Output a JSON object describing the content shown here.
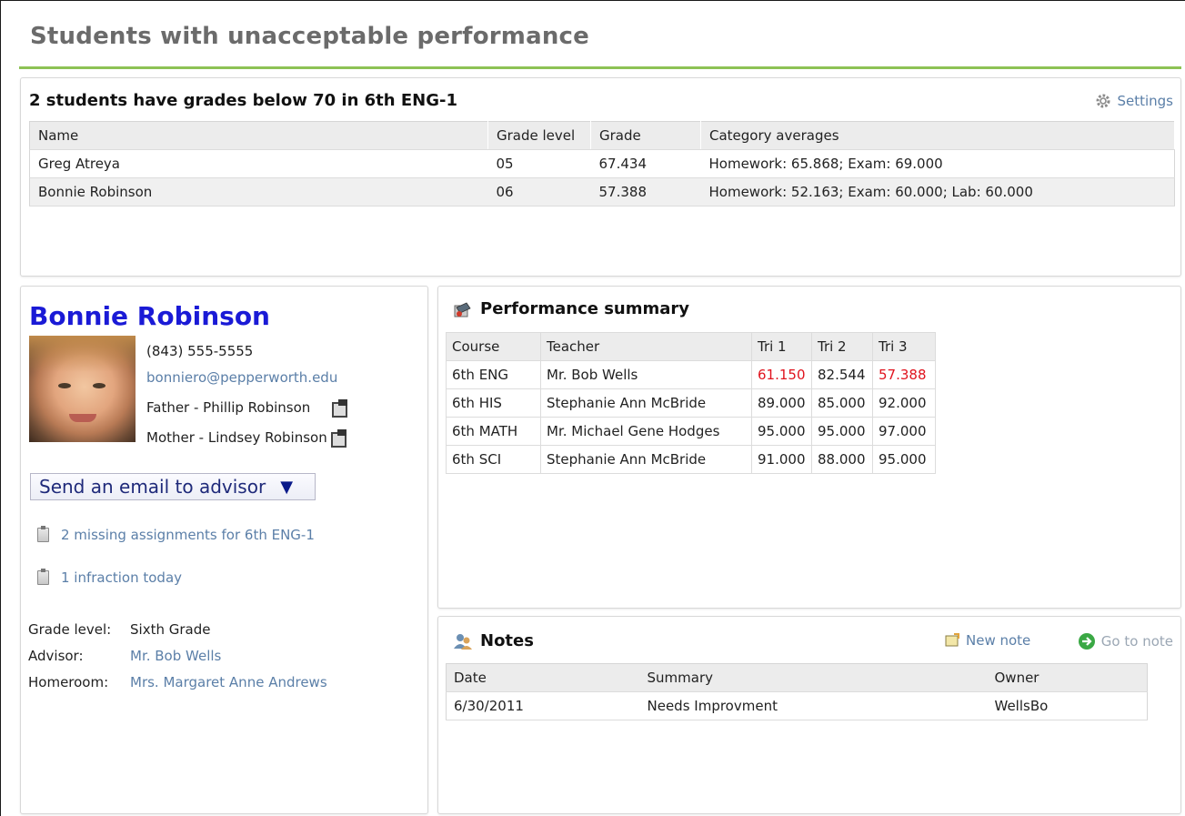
{
  "page": {
    "title": "Students with unacceptable performance"
  },
  "students_panel": {
    "heading": "2 students have grades below 70 in 6th ENG-1",
    "settings_label": "Settings",
    "columns": [
      "Name",
      "Grade level",
      "Grade",
      "Category averages"
    ],
    "rows": [
      {
        "name": "Greg Atreya",
        "grade_level": "05",
        "grade": "67.434",
        "category_averages": "Homework: 65.868; Exam: 69.000"
      },
      {
        "name": "Bonnie Robinson",
        "grade_level": "06",
        "grade": "57.388",
        "category_averages": "Homework: 52.163; Exam: 60.000; Lab: 60.000"
      }
    ]
  },
  "student": {
    "name": "Bonnie Robinson",
    "phone": "(843) 555-5555",
    "email": "bonniero@pepperworth.edu",
    "father": "Father - Phillip Robinson",
    "mother": "Mother - Lindsey Robinson",
    "email_advisor_label": "Send an email to advisor",
    "alerts": [
      "2 missing assignments for 6th ENG-1",
      "1 infraction today"
    ],
    "grade_level_label": "Grade level:",
    "grade_level": "Sixth Grade",
    "advisor_label": "Advisor:",
    "advisor": "Mr. Bob Wells",
    "homeroom_label": "Homeroom:",
    "homeroom": "Mrs. Margaret Anne Andrews"
  },
  "performance": {
    "heading": "Performance summary",
    "columns": [
      "Course",
      "Teacher",
      "Tri 1",
      "Tri 2",
      "Tri 3"
    ],
    "rows": [
      {
        "course": "6th ENG",
        "teacher": "Mr. Bob Wells",
        "tri1": "61.150",
        "tri2": "82.544",
        "tri3": "57.388",
        "tri1_low": true,
        "tri2_low": false,
        "tri3_low": true
      },
      {
        "course": "6th HIS",
        "teacher": "Stephanie Ann McBride",
        "tri1": "89.000",
        "tri2": "85.000",
        "tri3": "92.000",
        "tri1_low": false,
        "tri2_low": false,
        "tri3_low": false
      },
      {
        "course": "6th MATH",
        "teacher": "Mr. Michael Gene Hodges",
        "tri1": "95.000",
        "tri2": "95.000",
        "tri3": "97.000",
        "tri1_low": false,
        "tri2_low": false,
        "tri3_low": false
      },
      {
        "course": "6th SCI",
        "teacher": "Stephanie Ann McBride",
        "tri1": "91.000",
        "tri2": "88.000",
        "tri3": "95.000",
        "tri1_low": false,
        "tri2_low": false,
        "tri3_low": false
      }
    ]
  },
  "notes": {
    "heading": "Notes",
    "new_note_label": "New note",
    "go_to_note_label": "Go to note",
    "columns": [
      "Date",
      "Summary",
      "Owner"
    ],
    "rows": [
      {
        "date": "6/30/2011",
        "summary": "Needs Improvment",
        "owner": "WellsBo"
      }
    ]
  },
  "colors": {
    "accent_rule": "#8dc255",
    "name_blue": "#1a1ad6",
    "link": "#5b7fa8",
    "low_grade": "#e0141e"
  }
}
